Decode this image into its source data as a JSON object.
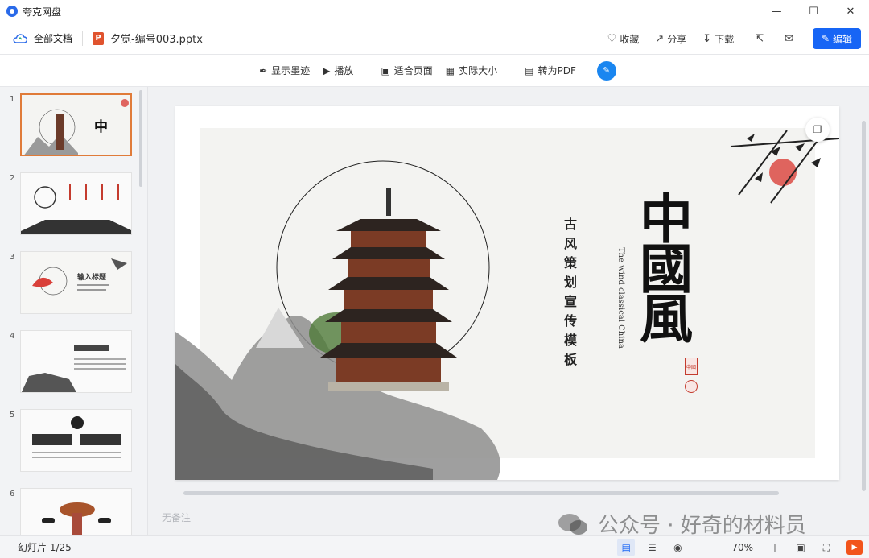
{
  "titlebar": {
    "app_name": "夸克网盘",
    "logo_icon": "quark-logo-icon",
    "minimize_icon": "minimize-icon",
    "maximize_icon": "maximize-icon",
    "close_icon": "close-icon"
  },
  "header": {
    "all_docs_label": "全部文档",
    "file_type_badge": "P",
    "file_name": "夕觉-编号003.pptx",
    "actions": {
      "favorite": "收藏",
      "share": "分享",
      "download": "下载"
    },
    "edit_label": "编辑",
    "brand_color": "#1765f5"
  },
  "toolbar": {
    "show_ink": "显示墨迹",
    "play": "播放",
    "fit_page": "适合页面",
    "actual_size": "实际大小",
    "to_pdf": "转为PDF"
  },
  "sidebar": {
    "thumbnails": [
      {
        "num": "1",
        "active": true
      },
      {
        "num": "2",
        "active": false
      },
      {
        "num": "3",
        "active": false,
        "caption": "输入标题"
      },
      {
        "num": "4",
        "active": false
      },
      {
        "num": "5",
        "active": false
      },
      {
        "num": "6",
        "active": false
      }
    ]
  },
  "slide": {
    "title": "中國風",
    "subtitle": "古风策划宣传模板",
    "english_subtitle": "The wind classical China",
    "seal_text": "中國"
  },
  "main": {
    "notes_placeholder": "无备注",
    "watermark": "公众号 · 好奇的材料员"
  },
  "statusbar": {
    "slide_count": "幻灯片 1/25",
    "zoom_level": "70%"
  }
}
